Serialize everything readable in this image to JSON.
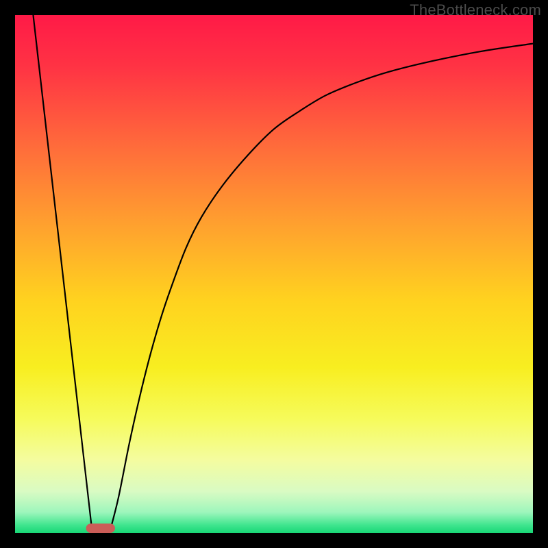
{
  "watermark": "TheBottleneck.com",
  "chart_data": {
    "type": "line",
    "title": "",
    "xlabel": "",
    "ylabel": "",
    "xlim": [
      0,
      100
    ],
    "ylim": [
      0,
      100
    ],
    "legend": false,
    "grid": false,
    "background": {
      "type": "vertical-gradient",
      "stops": [
        {
          "offset": 0.0,
          "color": "#ff1a47"
        },
        {
          "offset": 0.1,
          "color": "#ff3344"
        },
        {
          "offset": 0.25,
          "color": "#ff6a3b"
        },
        {
          "offset": 0.4,
          "color": "#ff9f2f"
        },
        {
          "offset": 0.55,
          "color": "#ffd21f"
        },
        {
          "offset": 0.68,
          "color": "#f8ee20"
        },
        {
          "offset": 0.78,
          "color": "#f6fb5b"
        },
        {
          "offset": 0.86,
          "color": "#f4fca0"
        },
        {
          "offset": 0.92,
          "color": "#d9fbc3"
        },
        {
          "offset": 0.96,
          "color": "#9ef6bc"
        },
        {
          "offset": 0.985,
          "color": "#3fe58e"
        },
        {
          "offset": 1.0,
          "color": "#18d776"
        }
      ]
    },
    "series": [
      {
        "name": "left-branch",
        "x": [
          3.5,
          14.8
        ],
        "y": [
          100,
          1.0
        ]
      },
      {
        "name": "right-branch",
        "x": [
          18.5,
          20,
          22,
          24,
          26,
          28,
          30,
          33,
          36,
          40,
          45,
          50,
          55,
          60,
          66,
          72,
          80,
          90,
          100
        ],
        "y": [
          1.0,
          7,
          17,
          26,
          34,
          41,
          47,
          55,
          61,
          67,
          73,
          78,
          81.5,
          84.5,
          87,
          89,
          91,
          93,
          94.5
        ]
      }
    ],
    "marker": {
      "name": "bottom-marker",
      "shape": "rounded-rect",
      "x_center": 16.5,
      "y_center": 0.9,
      "width": 5.6,
      "height": 1.8,
      "color": "#cb5d58"
    }
  }
}
